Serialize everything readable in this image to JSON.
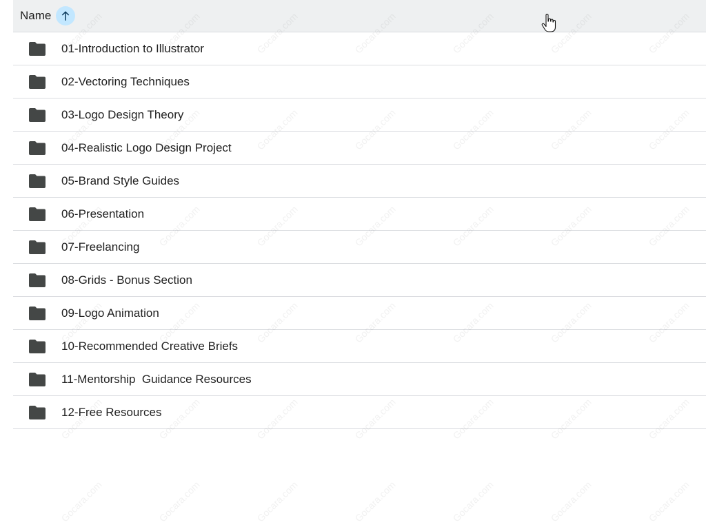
{
  "header": {
    "column_label": "Name",
    "sort_icon": "arrow-up-icon",
    "sort_color": "#c2e7ff"
  },
  "folders": [
    {
      "name": "01-Introduction to Illustrator"
    },
    {
      "name": "02-Vectoring Techniques"
    },
    {
      "name": "03-Logo Design Theory"
    },
    {
      "name": "04-Realistic Logo Design Project"
    },
    {
      "name": "05-Brand Style Guides"
    },
    {
      "name": "06-Presentation"
    },
    {
      "name": "07-Freelancing"
    },
    {
      "name": "08-Grids - Bonus Section"
    },
    {
      "name": "09-Logo Animation"
    },
    {
      "name": "10-Recommended Creative Briefs"
    },
    {
      "name": "11-Mentorship  Guidance Resources"
    },
    {
      "name": "12-Free Resources"
    }
  ],
  "watermark": "Gocara.com",
  "colors": {
    "header_bg": "#eef0f1",
    "divider": "#dadce0",
    "folder_icon": "#444746",
    "text": "#1f1f1f"
  }
}
